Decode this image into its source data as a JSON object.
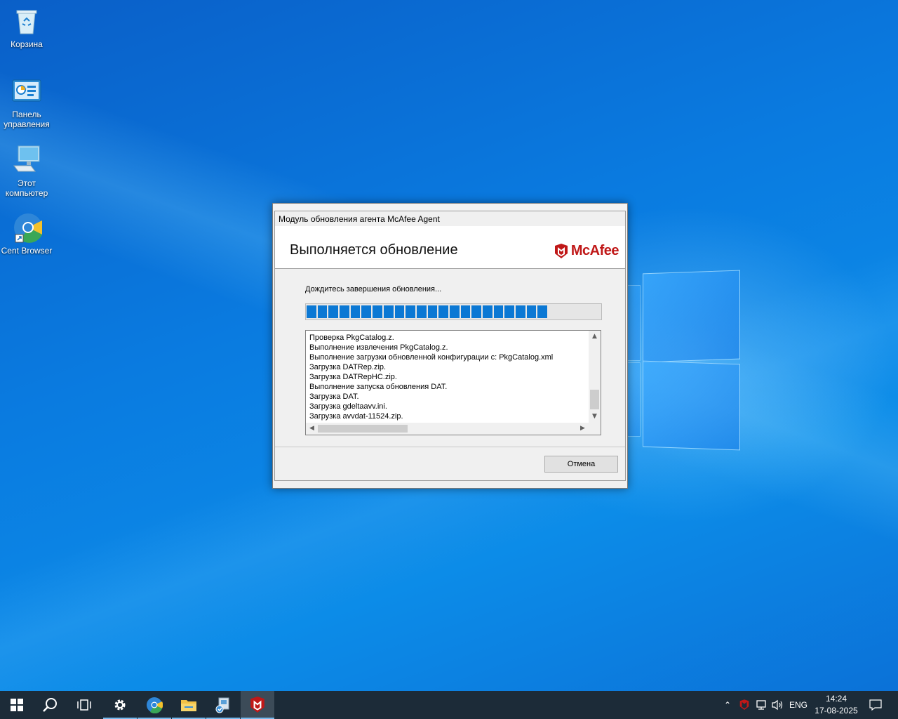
{
  "desktop": {
    "icons": [
      {
        "label": "Корзина",
        "icon": "recycle-bin-icon"
      },
      {
        "label": "Панель управления",
        "icon": "control-panel-icon"
      },
      {
        "label": "Этот компьютер",
        "icon": "this-pc-icon"
      },
      {
        "label": "Cent Browser",
        "icon": "cent-browser-icon"
      }
    ]
  },
  "dialog": {
    "title": "Модуль обновления агента McAfee Agent",
    "heading": "Выполняется обновление",
    "brand": "McAfee",
    "status": "Дождитесь завершения обновления...",
    "progress": 0.8,
    "log_lines": [
      "Проверка PkgCatalog.z.",
      "Выполнение извлечения PkgCatalog.z.",
      "Выполнение загрузки обновленной конфигурации с: PkgCatalog.xml",
      "Загрузка DATRep.zip.",
      "Загрузка DATRepHC.zip.",
      "Выполнение запуска обновления DAT.",
      "Загрузка DAT.",
      "Загрузка gdeltaavv.ini.",
      "Загрузка avvdat-11524.zip."
    ],
    "cancel_label": "Отмена",
    "brand_color": "#c01818",
    "progress_color": "#0b78d4"
  },
  "taskbar": {
    "items": [
      {
        "name": "start-button",
        "icon": "windows-logo-icon"
      },
      {
        "name": "search-button",
        "icon": "search-icon"
      },
      {
        "name": "task-view-button",
        "icon": "task-view-icon"
      },
      {
        "name": "settings-button",
        "icon": "gear-icon"
      },
      {
        "name": "cent-browser-button",
        "icon": "cent-browser-icon"
      },
      {
        "name": "file-explorer-button",
        "icon": "folder-icon"
      },
      {
        "name": "installer-button",
        "icon": "installer-icon"
      },
      {
        "name": "mcafee-button",
        "icon": "mcafee-shield-icon"
      }
    ],
    "tray": {
      "language": "ENG",
      "time": "14:24",
      "date": "17-08-2025"
    }
  }
}
